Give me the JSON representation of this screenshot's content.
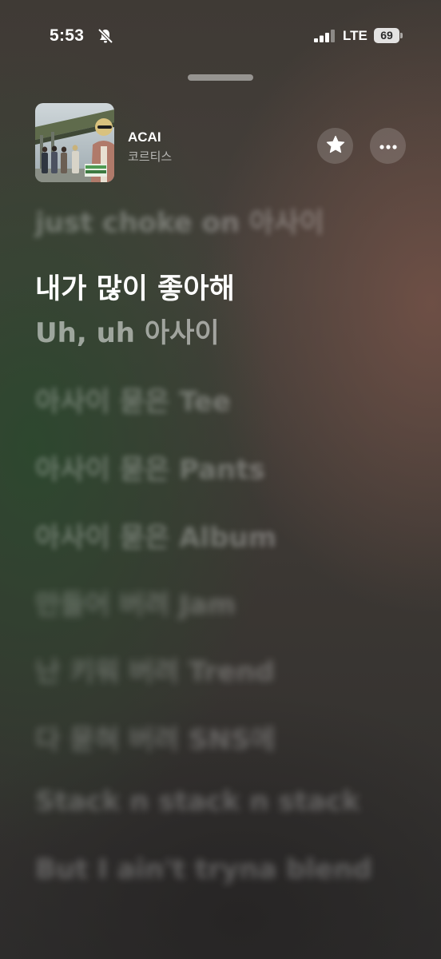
{
  "status_bar": {
    "time": "5:53",
    "network": "LTE",
    "battery": "69"
  },
  "now_playing": {
    "title": "ACAI",
    "artist": "코르티스"
  },
  "lyrics": {
    "previous": "just choke on 아사이",
    "current": "내가 많이 좋아해",
    "next": "Uh, uh 아사이",
    "upcoming": [
      "아사이 묻은 Tee",
      "아사이 묻은 Pants",
      "아사이 묻은 Album",
      "만들어 버려 Jam",
      "난 키워 버려 Trend",
      "다 묻혀 버려 SNS에",
      "Stack n stack n stack",
      "But I ain't tryna blend"
    ]
  },
  "icons": {
    "silent": "bell-slash-icon",
    "signal": "cellular-signal-icon",
    "favorite": "star-icon",
    "more": "ellipsis-icon"
  }
}
